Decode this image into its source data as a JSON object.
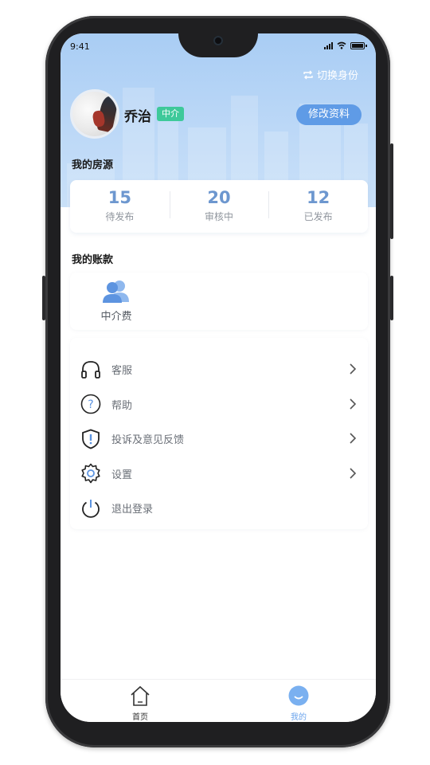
{
  "status_bar": {
    "time": "9:41"
  },
  "header": {
    "switch_identity": "切换身份",
    "user_name": "乔治",
    "role_badge": "中介",
    "edit_profile": "修改资料",
    "section_my_listings": "我的房源"
  },
  "stats": [
    {
      "value": "15",
      "label": "待发布"
    },
    {
      "value": "20",
      "label": "审核中"
    },
    {
      "value": "12",
      "label": "已发布"
    }
  ],
  "account": {
    "section_title": "我的账款",
    "items": [
      {
        "label": "中介费",
        "icon": "people-icon"
      }
    ]
  },
  "menu": [
    {
      "label": "客服",
      "icon": "headset-icon",
      "has_arrow": true
    },
    {
      "label": "帮助",
      "icon": "help-icon",
      "has_arrow": true
    },
    {
      "label": "投诉及意见反馈",
      "icon": "shield-alert-icon",
      "has_arrow": true
    },
    {
      "label": "设置",
      "icon": "gear-icon",
      "has_arrow": true
    },
    {
      "label": "退出登录",
      "icon": "power-icon",
      "has_arrow": false
    }
  ],
  "tabbar": [
    {
      "label": "首页",
      "icon": "home-icon",
      "active": false
    },
    {
      "label": "我的",
      "icon": "profile-icon",
      "active": true
    }
  ],
  "colors": {
    "header_bg": "#bcd8f7",
    "accent_blue": "#5f9be6",
    "stat_number": "#6d97cf",
    "badge_green": "#3ec99a",
    "active_tab": "#6aa3ec"
  }
}
